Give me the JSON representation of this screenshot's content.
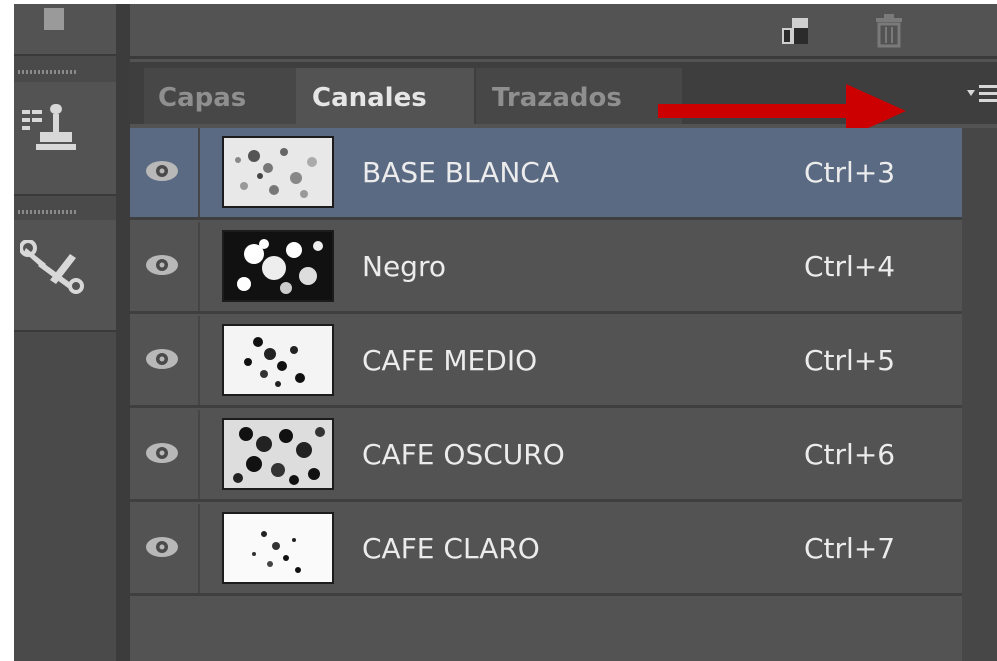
{
  "panel": {
    "tabs": [
      {
        "label": "Capas",
        "active": false
      },
      {
        "label": "Canales",
        "active": true
      },
      {
        "label": "Trazados",
        "active": false
      }
    ],
    "menu_icon": "panel-menu-icon"
  },
  "toolbar": {
    "icons": [
      "new-channel-icon",
      "trash-icon"
    ]
  },
  "tools": {
    "icons": [
      "clone-stamp-icon",
      "tools-wrench-icon"
    ]
  },
  "channels": [
    {
      "name": "BASE BLANCA",
      "shortcut": "Ctrl+3",
      "selected": true,
      "visible": true
    },
    {
      "name": "Negro",
      "shortcut": "Ctrl+4",
      "selected": false,
      "visible": true
    },
    {
      "name": "CAFE MEDIO",
      "shortcut": "Ctrl+5",
      "selected": false,
      "visible": true
    },
    {
      "name": "CAFE OSCURO",
      "shortcut": "Ctrl+6",
      "selected": false,
      "visible": true
    },
    {
      "name": "CAFE CLARO",
      "shortcut": "Ctrl+7",
      "selected": false,
      "visible": true
    }
  ],
  "colors": {
    "panel_bg": "#535353",
    "selected_row": "#5a6a83",
    "annotation_arrow": "#cc0000"
  }
}
